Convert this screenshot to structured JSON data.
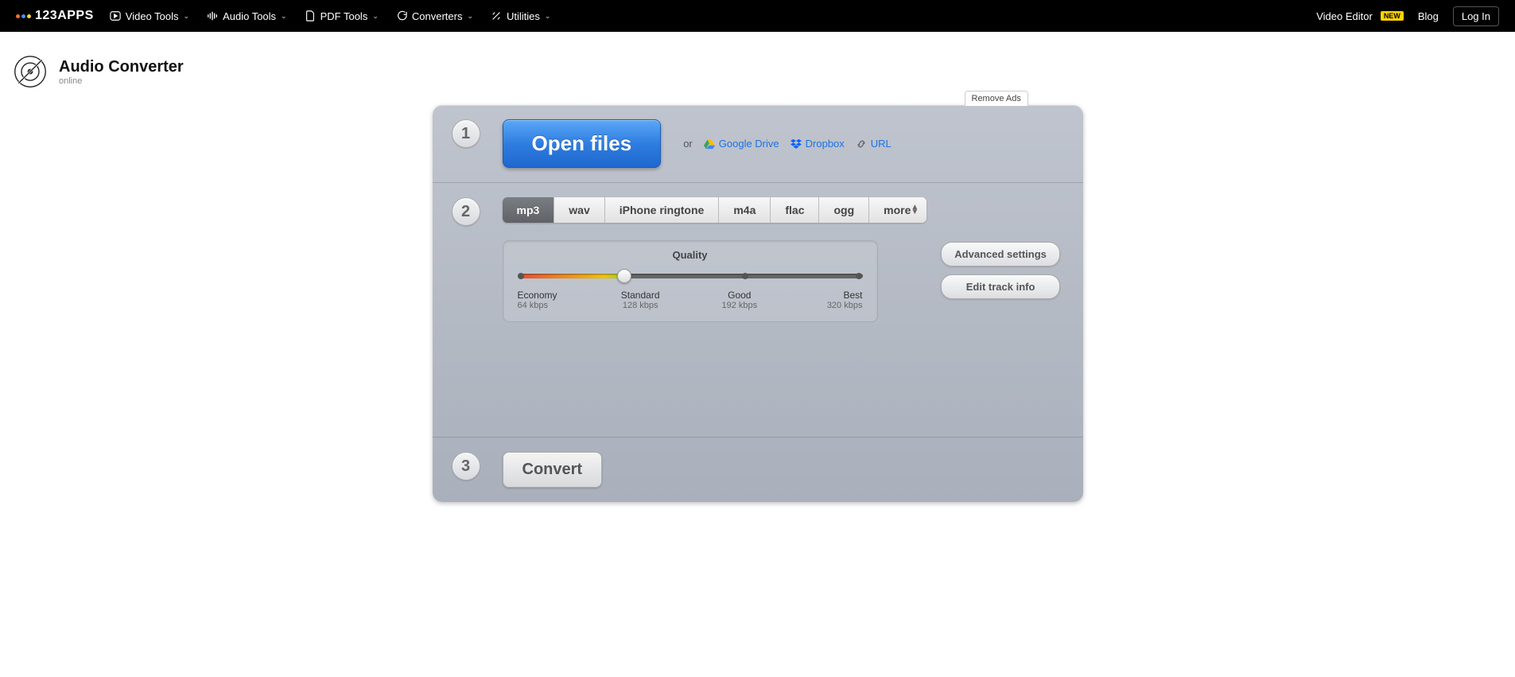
{
  "nav": {
    "brand": "123APPS",
    "items": [
      {
        "label": "Video Tools"
      },
      {
        "label": "Audio Tools"
      },
      {
        "label": "PDF Tools"
      },
      {
        "label": "Converters"
      },
      {
        "label": "Utilities"
      }
    ],
    "right": {
      "video_editor": "Video Editor",
      "new_badge": "NEW",
      "blog": "Blog",
      "login": "Log In"
    }
  },
  "header": {
    "title": "Audio Converter",
    "subtitle": "online"
  },
  "remove_ads": "Remove Ads",
  "step1": {
    "num": "1",
    "open": "Open files",
    "or": "or",
    "sources": {
      "gdrive": "Google Drive",
      "dropbox": "Dropbox",
      "url": "URL"
    }
  },
  "step2": {
    "num": "2",
    "formats": [
      "mp3",
      "wav",
      "iPhone ringtone",
      "m4a",
      "flac",
      "ogg"
    ],
    "more": "more",
    "quality": {
      "title": "Quality",
      "stops": [
        {
          "label": "Economy",
          "sub": "64 kbps"
        },
        {
          "label": "Standard",
          "sub": "128 kbps"
        },
        {
          "label": "Good",
          "sub": "192 kbps"
        },
        {
          "label": "Best",
          "sub": "320 kbps"
        }
      ]
    },
    "advanced": "Advanced settings",
    "edit_info": "Edit track info"
  },
  "step3": {
    "num": "3",
    "convert": "Convert"
  }
}
